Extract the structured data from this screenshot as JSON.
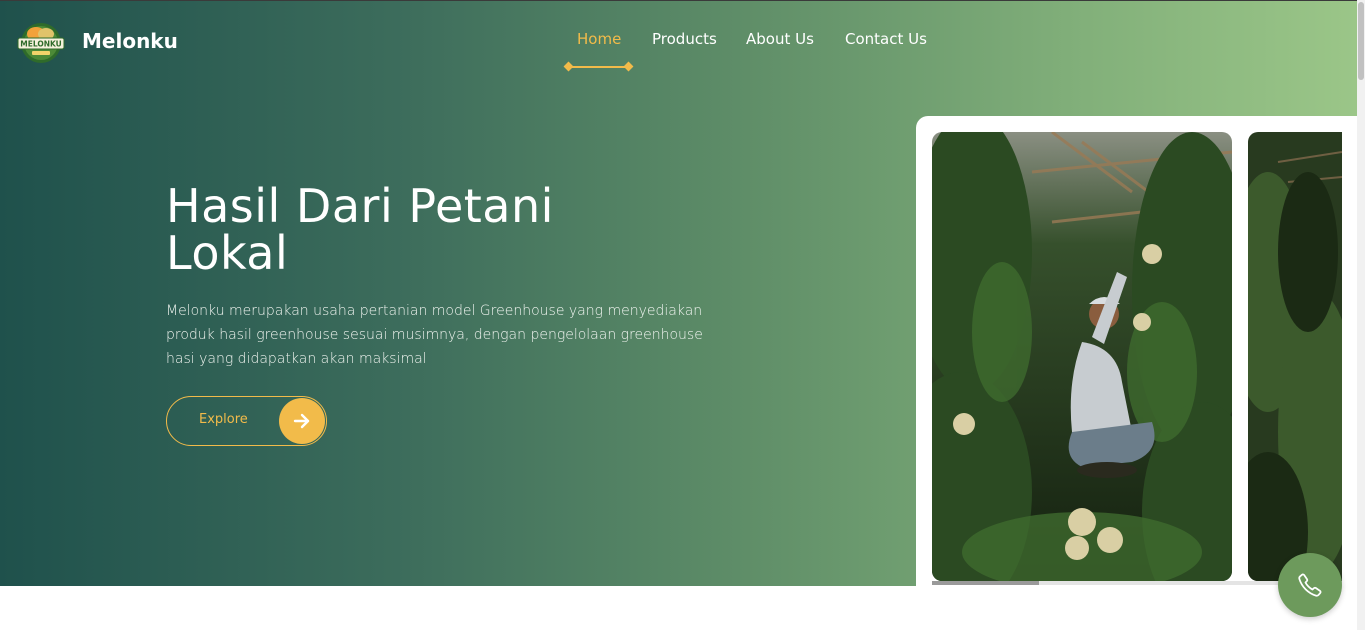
{
  "header": {
    "brand": "Melonku",
    "logo_text": "MELONKU",
    "nav": [
      {
        "label": "Home",
        "active": true
      },
      {
        "label": "Products",
        "active": false
      },
      {
        "label": "About Us",
        "active": false
      },
      {
        "label": "Contact Us",
        "active": false
      }
    ]
  },
  "hero": {
    "title": "Hasil Dari Petani Lokal",
    "description": "Melonku merupakan usaha pertanian model Greenhouse yang menyediakan produk hasil greenhouse sesuai musimnya, dengan pengelolaan greenhouse hasi yang didapatkan akan maksimal",
    "explore_label": "Explore",
    "explore_icon": "arrow-right-icon"
  },
  "gallery": {
    "slides": [
      {
        "subject": "farmer-in-greenhouse-photo"
      },
      {
        "subject": "greenhouse-vines-photo"
      }
    ],
    "progress": 0.26
  },
  "fab": {
    "icon": "phone-icon"
  },
  "colors": {
    "accent": "#f2bb4a",
    "gradient_start": "#1f514c",
    "gradient_end": "#9bc688",
    "fab": "#6d9a5c"
  }
}
